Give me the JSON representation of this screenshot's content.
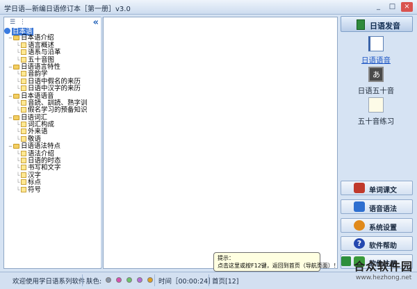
{
  "window": {
    "title": "学日语—新编日语修订本［第一册］v3.0",
    "minimize": "_",
    "maximize": "□",
    "close": "×"
  },
  "tree": {
    "collapse": "«",
    "root": "日本语",
    "groups": [
      {
        "label": "日本语介绍",
        "children": [
          "语言概述",
          "语系与沿革",
          "五十音图"
        ]
      },
      {
        "label": "日语语言特性",
        "children": [
          "音韵学",
          "日语中假名的来历",
          "日语中汉字的来历"
        ]
      },
      {
        "label": "日本语语音",
        "children": [
          "音読、訓読、熟字训",
          "假名学习的预备知识"
        ]
      },
      {
        "label": "日语词汇",
        "children": [
          "词汇构成",
          "外来语",
          "敬语"
        ]
      },
      {
        "label": "日语语法特点",
        "children": [
          "语法介绍",
          "日语的时态",
          "书写和文字",
          "汉字",
          "标点",
          "符号"
        ]
      }
    ]
  },
  "right_panel": {
    "main_button": "日语发音",
    "features": [
      {
        "label": "日语语音",
        "active": true
      },
      {
        "label": "日语五十音",
        "active": false
      },
      {
        "label": "五十音练习",
        "active": false
      }
    ],
    "buttons": [
      {
        "label": "单词课文",
        "color": "#c0392b"
      },
      {
        "label": "语音语法",
        "color": "#2e6fd0"
      },
      {
        "label": "系统设置",
        "color": "#e08a1c"
      },
      {
        "label": "软件帮助",
        "color": "#2448b0"
      },
      {
        "label": "软件注册",
        "color": "#3a9a3a"
      }
    ]
  },
  "tooltip": {
    "line1": "提示：",
    "line2": "点击这里或按F12键，返回到首页（导航页面）！"
  },
  "status": {
    "welcome": "欢迎使用学日语系列软件",
    "color_label": "肤色:",
    "swatches": [
      "#8a96a8",
      "#d84fb0",
      "#6bc46b",
      "#b56bd8",
      "#e0a020"
    ],
    "time": "时间［00:00:24］",
    "home": "首页[12]"
  },
  "watermark": {
    "logo": "合众软件园",
    "url": "www.hezhong.net"
  }
}
